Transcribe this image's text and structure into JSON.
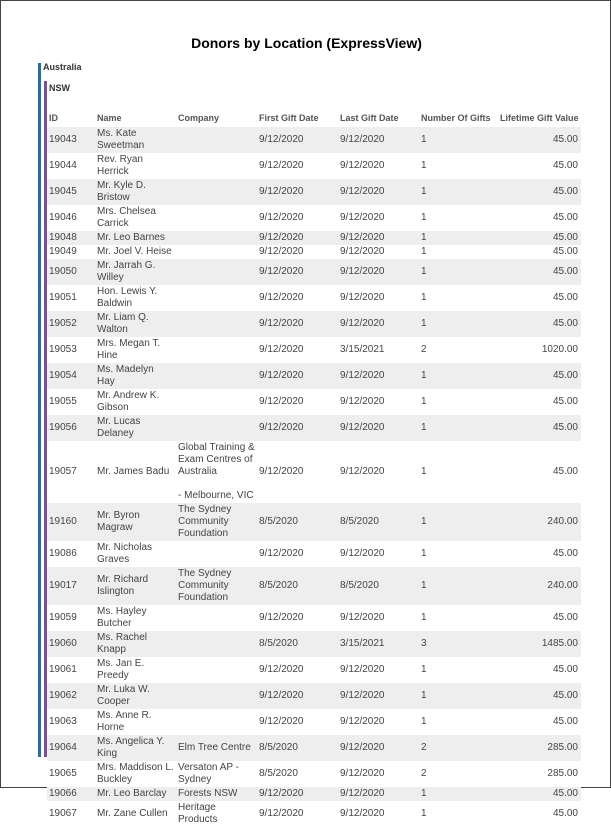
{
  "report": {
    "title": "Donors by Location (ExpressView)",
    "group_country": "Australia",
    "group_state": "NSW"
  },
  "columns": [
    "ID",
    "Name",
    "Company",
    "First Gift Date",
    "Last Gift Date",
    "Number Of Gifts",
    "Lifetime Gift Value"
  ],
  "rows": [
    {
      "id": "19043",
      "name": "Ms. Kate Sweetman",
      "company": "",
      "first": "9/12/2020",
      "last": "9/12/2020",
      "gifts": "1",
      "value": "45.00"
    },
    {
      "id": "19044",
      "name": "Rev. Ryan Herrick",
      "company": "",
      "first": "9/12/2020",
      "last": "9/12/2020",
      "gifts": "1",
      "value": "45.00"
    },
    {
      "id": "19045",
      "name": "Mr. Kyle D. Bristow",
      "company": "",
      "first": "9/12/2020",
      "last": "9/12/2020",
      "gifts": "1",
      "value": "45.00"
    },
    {
      "id": "19046",
      "name": "Mrs. Chelsea Carrick",
      "company": "",
      "first": "9/12/2020",
      "last": "9/12/2020",
      "gifts": "1",
      "value": "45.00"
    },
    {
      "id": "19048",
      "name": "Mr. Leo Barnes",
      "company": "",
      "first": "9/12/2020",
      "last": "9/12/2020",
      "gifts": "1",
      "value": "45.00"
    },
    {
      "id": "19049",
      "name": "Mr. Joel V. Heise",
      "company": "",
      "first": "9/12/2020",
      "last": "9/12/2020",
      "gifts": "1",
      "value": "45.00"
    },
    {
      "id": "19050",
      "name": "Mr. Jarrah G. Willey",
      "company": "",
      "first": "9/12/2020",
      "last": "9/12/2020",
      "gifts": "1",
      "value": "45.00"
    },
    {
      "id": "19051",
      "name": "Hon. Lewis Y. Baldwin",
      "company": "",
      "first": "9/12/2020",
      "last": "9/12/2020",
      "gifts": "1",
      "value": "45.00"
    },
    {
      "id": "19052",
      "name": "Mr. Liam Q. Walton",
      "company": "",
      "first": "9/12/2020",
      "last": "9/12/2020",
      "gifts": "1",
      "value": "45.00"
    },
    {
      "id": "19053",
      "name": "Mrs. Megan T. Hine",
      "company": "",
      "first": "9/12/2020",
      "last": "3/15/2021",
      "gifts": "2",
      "value": "1020.00"
    },
    {
      "id": "19054",
      "name": "Ms. Madelyn Hay",
      "company": "",
      "first": "9/12/2020",
      "last": "9/12/2020",
      "gifts": "1",
      "value": "45.00"
    },
    {
      "id": "19055",
      "name": "Mr. Andrew K. Gibson",
      "company": "",
      "first": "9/12/2020",
      "last": "9/12/2020",
      "gifts": "1",
      "value": "45.00"
    },
    {
      "id": "19056",
      "name": "Mr. Lucas Delaney",
      "company": "",
      "first": "9/12/2020",
      "last": "9/12/2020",
      "gifts": "1",
      "value": "45.00"
    },
    {
      "id": "19057",
      "name": "Mr. James Badu",
      "company": "Global Training & Exam Centres of Australia\n\n - Melbourne, VIC",
      "first": "9/12/2020",
      "last": "9/12/2020",
      "gifts": "1",
      "value": "45.00"
    },
    {
      "id": "19160",
      "name": "Mr. Byron Magraw",
      "company": "The Sydney Community Foundation",
      "first": "8/5/2020",
      "last": "8/5/2020",
      "gifts": "1",
      "value": "240.00"
    },
    {
      "id": "19086",
      "name": "Mr. Nicholas Graves",
      "company": "",
      "first": "9/12/2020",
      "last": "9/12/2020",
      "gifts": "1",
      "value": "45.00"
    },
    {
      "id": "19017",
      "name": "Mr. Richard Islington",
      "company": "The Sydney Community Foundation",
      "first": "8/5/2020",
      "last": "8/5/2020",
      "gifts": "1",
      "value": "240.00"
    },
    {
      "id": "19059",
      "name": "Ms. Hayley Butcher",
      "company": "",
      "first": "9/12/2020",
      "last": "9/12/2020",
      "gifts": "1",
      "value": "45.00"
    },
    {
      "id": "19060",
      "name": "Ms. Rachel Knapp",
      "company": "",
      "first": "8/5/2020",
      "last": "3/15/2021",
      "gifts": "3",
      "value": "1485.00"
    },
    {
      "id": "19061",
      "name": "Ms. Jan E. Preedy",
      "company": "",
      "first": "9/12/2020",
      "last": "9/12/2020",
      "gifts": "1",
      "value": "45.00"
    },
    {
      "id": "19062",
      "name": "Mr. Luka W. Cooper",
      "company": "",
      "first": "9/12/2020",
      "last": "9/12/2020",
      "gifts": "1",
      "value": "45.00"
    },
    {
      "id": "19063",
      "name": "Ms. Anne R. Horne",
      "company": "",
      "first": "9/12/2020",
      "last": "9/12/2020",
      "gifts": "1",
      "value": "45.00"
    },
    {
      "id": "19064",
      "name": "Ms. Angelica Y. King",
      "company": "Elm Tree Centre",
      "first": "8/5/2020",
      "last": "9/12/2020",
      "gifts": "2",
      "value": "285.00"
    },
    {
      "id": "19065",
      "name": "Mrs. Maddison L. Buckley",
      "company": "Versaton AP - Sydney",
      "first": "8/5/2020",
      "last": "9/12/2020",
      "gifts": "2",
      "value": "285.00"
    },
    {
      "id": "19066",
      "name": "Mr. Leo Barclay",
      "company": "Forests NSW",
      "first": "9/12/2020",
      "last": "9/12/2020",
      "gifts": "1",
      "value": "45.00"
    },
    {
      "id": "19067",
      "name": "Mr. Zane Cullen",
      "company": "Heritage Products",
      "first": "9/12/2020",
      "last": "9/12/2020",
      "gifts": "1",
      "value": "45.00"
    }
  ]
}
